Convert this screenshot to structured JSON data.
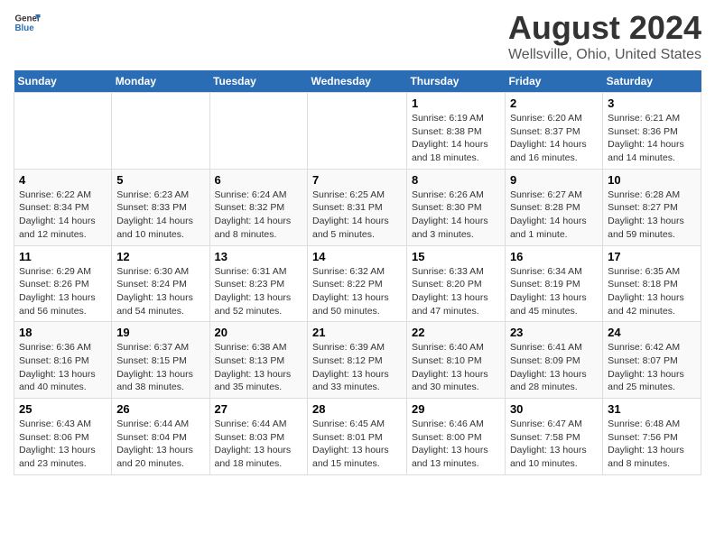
{
  "header": {
    "logo_general": "General",
    "logo_blue": "Blue",
    "title": "August 2024",
    "subtitle": "Wellsville, Ohio, United States"
  },
  "days_of_week": [
    "Sunday",
    "Monday",
    "Tuesday",
    "Wednesday",
    "Thursday",
    "Friday",
    "Saturday"
  ],
  "weeks": [
    [
      {
        "day": "",
        "info": ""
      },
      {
        "day": "",
        "info": ""
      },
      {
        "day": "",
        "info": ""
      },
      {
        "day": "",
        "info": ""
      },
      {
        "day": "1",
        "info": "Sunrise: 6:19 AM\nSunset: 8:38 PM\nDaylight: 14 hours\nand 18 minutes."
      },
      {
        "day": "2",
        "info": "Sunrise: 6:20 AM\nSunset: 8:37 PM\nDaylight: 14 hours\nand 16 minutes."
      },
      {
        "day": "3",
        "info": "Sunrise: 6:21 AM\nSunset: 8:36 PM\nDaylight: 14 hours\nand 14 minutes."
      }
    ],
    [
      {
        "day": "4",
        "info": "Sunrise: 6:22 AM\nSunset: 8:34 PM\nDaylight: 14 hours\nand 12 minutes."
      },
      {
        "day": "5",
        "info": "Sunrise: 6:23 AM\nSunset: 8:33 PM\nDaylight: 14 hours\nand 10 minutes."
      },
      {
        "day": "6",
        "info": "Sunrise: 6:24 AM\nSunset: 8:32 PM\nDaylight: 14 hours\nand 8 minutes."
      },
      {
        "day": "7",
        "info": "Sunrise: 6:25 AM\nSunset: 8:31 PM\nDaylight: 14 hours\nand 5 minutes."
      },
      {
        "day": "8",
        "info": "Sunrise: 6:26 AM\nSunset: 8:30 PM\nDaylight: 14 hours\nand 3 minutes."
      },
      {
        "day": "9",
        "info": "Sunrise: 6:27 AM\nSunset: 8:28 PM\nDaylight: 14 hours\nand 1 minute."
      },
      {
        "day": "10",
        "info": "Sunrise: 6:28 AM\nSunset: 8:27 PM\nDaylight: 13 hours\nand 59 minutes."
      }
    ],
    [
      {
        "day": "11",
        "info": "Sunrise: 6:29 AM\nSunset: 8:26 PM\nDaylight: 13 hours\nand 56 minutes."
      },
      {
        "day": "12",
        "info": "Sunrise: 6:30 AM\nSunset: 8:24 PM\nDaylight: 13 hours\nand 54 minutes."
      },
      {
        "day": "13",
        "info": "Sunrise: 6:31 AM\nSunset: 8:23 PM\nDaylight: 13 hours\nand 52 minutes."
      },
      {
        "day": "14",
        "info": "Sunrise: 6:32 AM\nSunset: 8:22 PM\nDaylight: 13 hours\nand 50 minutes."
      },
      {
        "day": "15",
        "info": "Sunrise: 6:33 AM\nSunset: 8:20 PM\nDaylight: 13 hours\nand 47 minutes."
      },
      {
        "day": "16",
        "info": "Sunrise: 6:34 AM\nSunset: 8:19 PM\nDaylight: 13 hours\nand 45 minutes."
      },
      {
        "day": "17",
        "info": "Sunrise: 6:35 AM\nSunset: 8:18 PM\nDaylight: 13 hours\nand 42 minutes."
      }
    ],
    [
      {
        "day": "18",
        "info": "Sunrise: 6:36 AM\nSunset: 8:16 PM\nDaylight: 13 hours\nand 40 minutes."
      },
      {
        "day": "19",
        "info": "Sunrise: 6:37 AM\nSunset: 8:15 PM\nDaylight: 13 hours\nand 38 minutes."
      },
      {
        "day": "20",
        "info": "Sunrise: 6:38 AM\nSunset: 8:13 PM\nDaylight: 13 hours\nand 35 minutes."
      },
      {
        "day": "21",
        "info": "Sunrise: 6:39 AM\nSunset: 8:12 PM\nDaylight: 13 hours\nand 33 minutes."
      },
      {
        "day": "22",
        "info": "Sunrise: 6:40 AM\nSunset: 8:10 PM\nDaylight: 13 hours\nand 30 minutes."
      },
      {
        "day": "23",
        "info": "Sunrise: 6:41 AM\nSunset: 8:09 PM\nDaylight: 13 hours\nand 28 minutes."
      },
      {
        "day": "24",
        "info": "Sunrise: 6:42 AM\nSunset: 8:07 PM\nDaylight: 13 hours\nand 25 minutes."
      }
    ],
    [
      {
        "day": "25",
        "info": "Sunrise: 6:43 AM\nSunset: 8:06 PM\nDaylight: 13 hours\nand 23 minutes."
      },
      {
        "day": "26",
        "info": "Sunrise: 6:44 AM\nSunset: 8:04 PM\nDaylight: 13 hours\nand 20 minutes."
      },
      {
        "day": "27",
        "info": "Sunrise: 6:44 AM\nSunset: 8:03 PM\nDaylight: 13 hours\nand 18 minutes."
      },
      {
        "day": "28",
        "info": "Sunrise: 6:45 AM\nSunset: 8:01 PM\nDaylight: 13 hours\nand 15 minutes."
      },
      {
        "day": "29",
        "info": "Sunrise: 6:46 AM\nSunset: 8:00 PM\nDaylight: 13 hours\nand 13 minutes."
      },
      {
        "day": "30",
        "info": "Sunrise: 6:47 AM\nSunset: 7:58 PM\nDaylight: 13 hours\nand 10 minutes."
      },
      {
        "day": "31",
        "info": "Sunrise: 6:48 AM\nSunset: 7:56 PM\nDaylight: 13 hours\nand 8 minutes."
      }
    ]
  ]
}
